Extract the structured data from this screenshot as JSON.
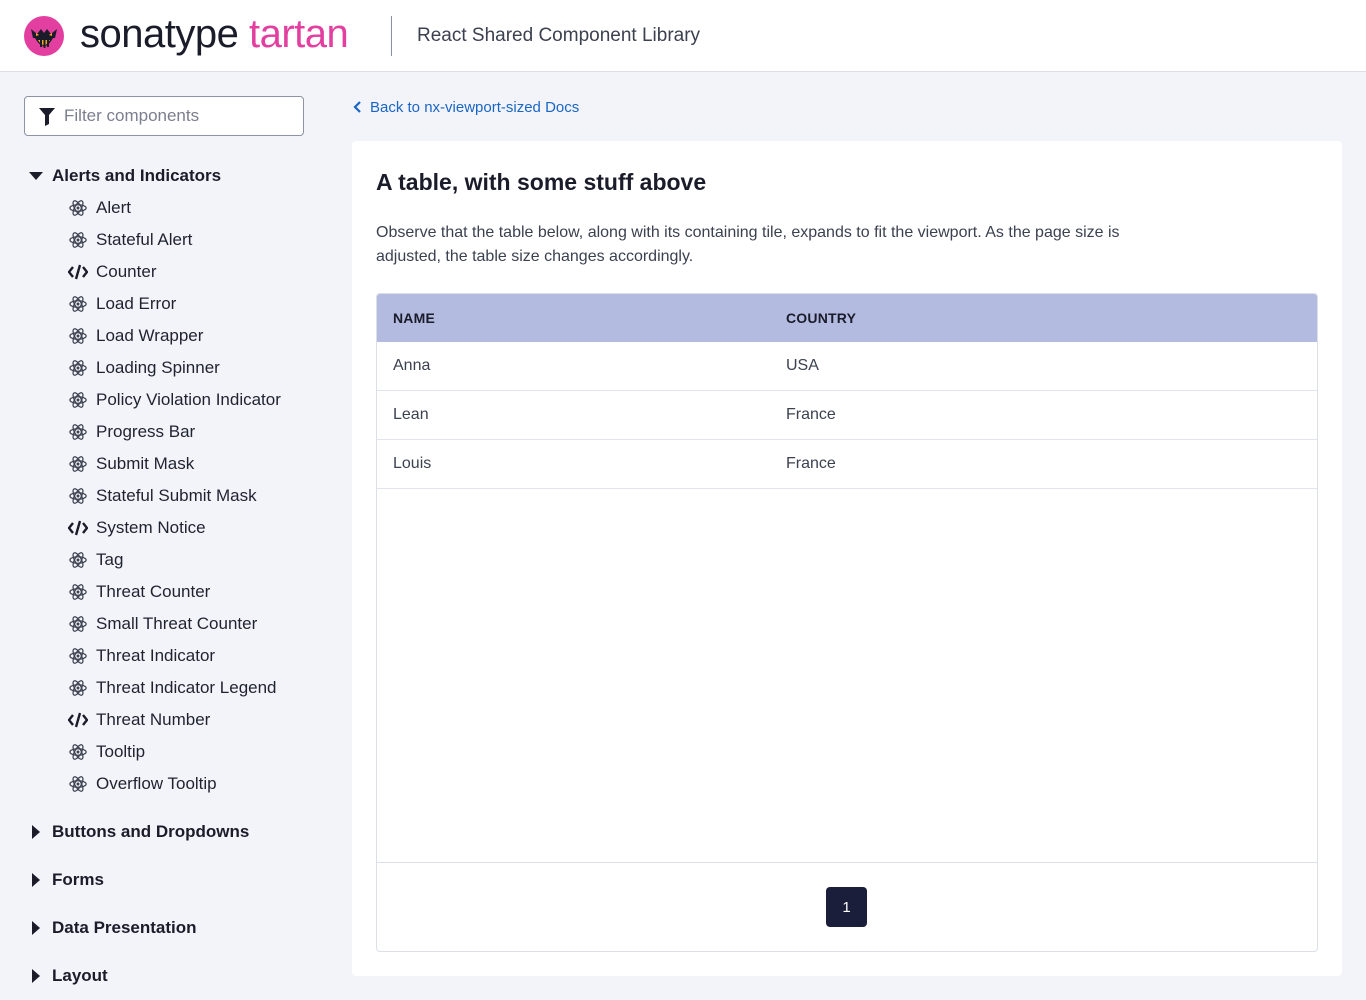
{
  "header": {
    "brand_primary": "sonatype",
    "brand_secondary": "tartan",
    "subtitle": "React Shared Component Library",
    "brand_color": "#e23fa0"
  },
  "sidebar": {
    "filter_placeholder": "Filter components",
    "groups": [
      {
        "label": "Alerts and Indicators",
        "expanded": true,
        "items": [
          {
            "label": "Alert",
            "icon": "react-icon"
          },
          {
            "label": "Stateful Alert",
            "icon": "react-icon"
          },
          {
            "label": "Counter",
            "icon": "code-icon"
          },
          {
            "label": "Load Error",
            "icon": "react-icon"
          },
          {
            "label": "Load Wrapper",
            "icon": "react-icon"
          },
          {
            "label": "Loading Spinner",
            "icon": "react-icon"
          },
          {
            "label": "Policy Violation Indicator",
            "icon": "react-icon"
          },
          {
            "label": "Progress Bar",
            "icon": "react-icon"
          },
          {
            "label": "Submit Mask",
            "icon": "react-icon"
          },
          {
            "label": "Stateful Submit Mask",
            "icon": "react-icon"
          },
          {
            "label": "System Notice",
            "icon": "code-icon"
          },
          {
            "label": "Tag",
            "icon": "react-icon"
          },
          {
            "label": "Threat Counter",
            "icon": "react-icon"
          },
          {
            "label": "Small Threat Counter",
            "icon": "react-icon"
          },
          {
            "label": "Threat Indicator",
            "icon": "react-icon"
          },
          {
            "label": "Threat Indicator Legend",
            "icon": "react-icon"
          },
          {
            "label": "Threat Number",
            "icon": "code-icon"
          },
          {
            "label": "Tooltip",
            "icon": "react-icon"
          },
          {
            "label": "Overflow Tooltip",
            "icon": "react-icon"
          }
        ]
      },
      {
        "label": "Buttons and Dropdowns",
        "expanded": false
      },
      {
        "label": "Forms",
        "expanded": false
      },
      {
        "label": "Data Presentation",
        "expanded": false
      },
      {
        "label": "Layout",
        "expanded": false
      }
    ]
  },
  "main": {
    "back_link": "Back to nx-viewport-sized Docs",
    "title": "A table, with some stuff above",
    "description": "Observe that the table below, along with its containing tile, expands to fit the viewport. As the page size is adjusted, the table size changes accordingly.",
    "table": {
      "columns": [
        "NAME",
        "COUNTRY"
      ],
      "rows": [
        [
          "Anna",
          "USA"
        ],
        [
          "Lean",
          "France"
        ],
        [
          "Louis",
          "France"
        ]
      ],
      "header_color": "#b3bbe1"
    },
    "pagination": {
      "current_page": "1"
    }
  }
}
